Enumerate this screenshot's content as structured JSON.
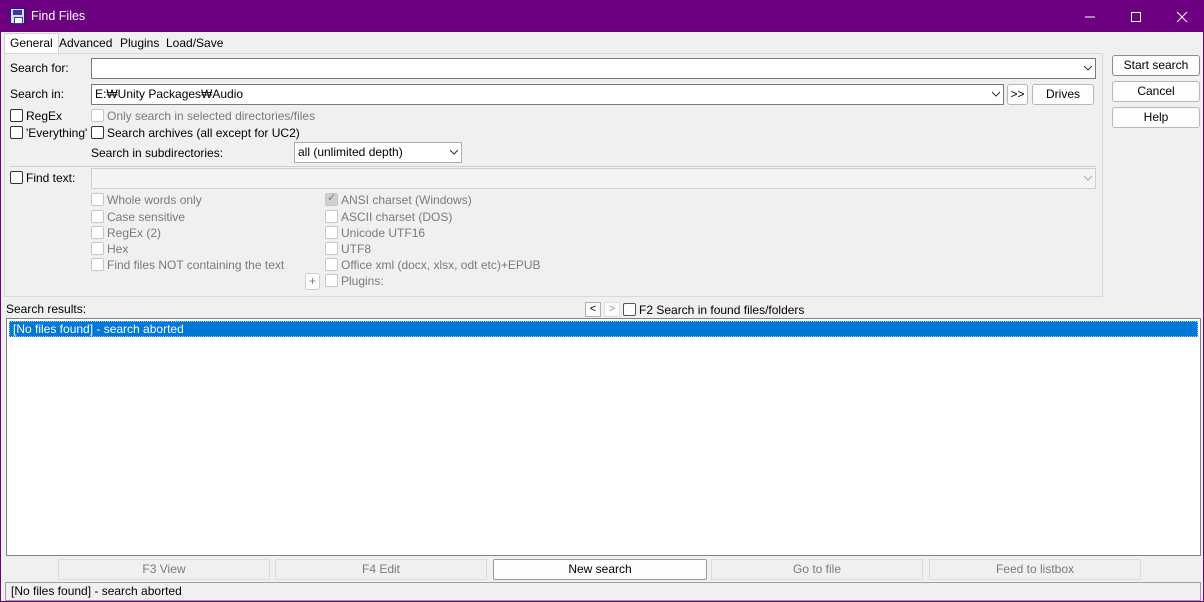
{
  "window": {
    "title": "Find Files",
    "controls": [
      "minimize-icon",
      "maximize-icon",
      "close-icon"
    ]
  },
  "tabs": [
    "General",
    "Advanced",
    "Plugins",
    "Load/Save"
  ],
  "general": {
    "search_for_label": "Search for:",
    "search_for_value": "",
    "search_in_label": "Search in:",
    "search_in_value": "E:₩Unity Packages₩Audio",
    "more_button": ">>",
    "drives_button": "Drives",
    "regex_label": "RegEx",
    "everything_label": "'Everything'",
    "only_selected_label": "Only search in selected directories/files",
    "search_archives_label": "Search archives (all except for UC2)",
    "subdirs_label": "Search in subdirectories:",
    "subdirs_value": "all (unlimited depth)",
    "find_text_label": "Find text:",
    "find_text_value": "",
    "text_options_left": [
      "Whole words only",
      "Case sensitive",
      "RegEx (2)",
      "Hex",
      "Find files NOT containing the text"
    ],
    "text_options_right": [
      "ANSI charset (Windows)",
      "ASCII charset (DOS)",
      "Unicode UTF16",
      "UTF8",
      "Office xml (docx, xlsx, odt etc)+EPUB",
      "Plugins:"
    ],
    "plus_button": "+"
  },
  "side_buttons": {
    "start": "Start search",
    "cancel": "Cancel",
    "help": "Help"
  },
  "results": {
    "label": "Search results:",
    "prev": "<",
    "next": ">",
    "f2_label": "F2 Search in found files/folders",
    "items": [
      "[No files found] - search aborted"
    ]
  },
  "footer_buttons": {
    "view": "F3 View",
    "edit": "F4 Edit",
    "new_search": "New search",
    "goto": "Go to file",
    "feed": "Feed to listbox"
  },
  "status": "[No files found] - search aborted",
  "colors": {
    "titlebar": "#6c0080",
    "selection": "#0078d7"
  }
}
